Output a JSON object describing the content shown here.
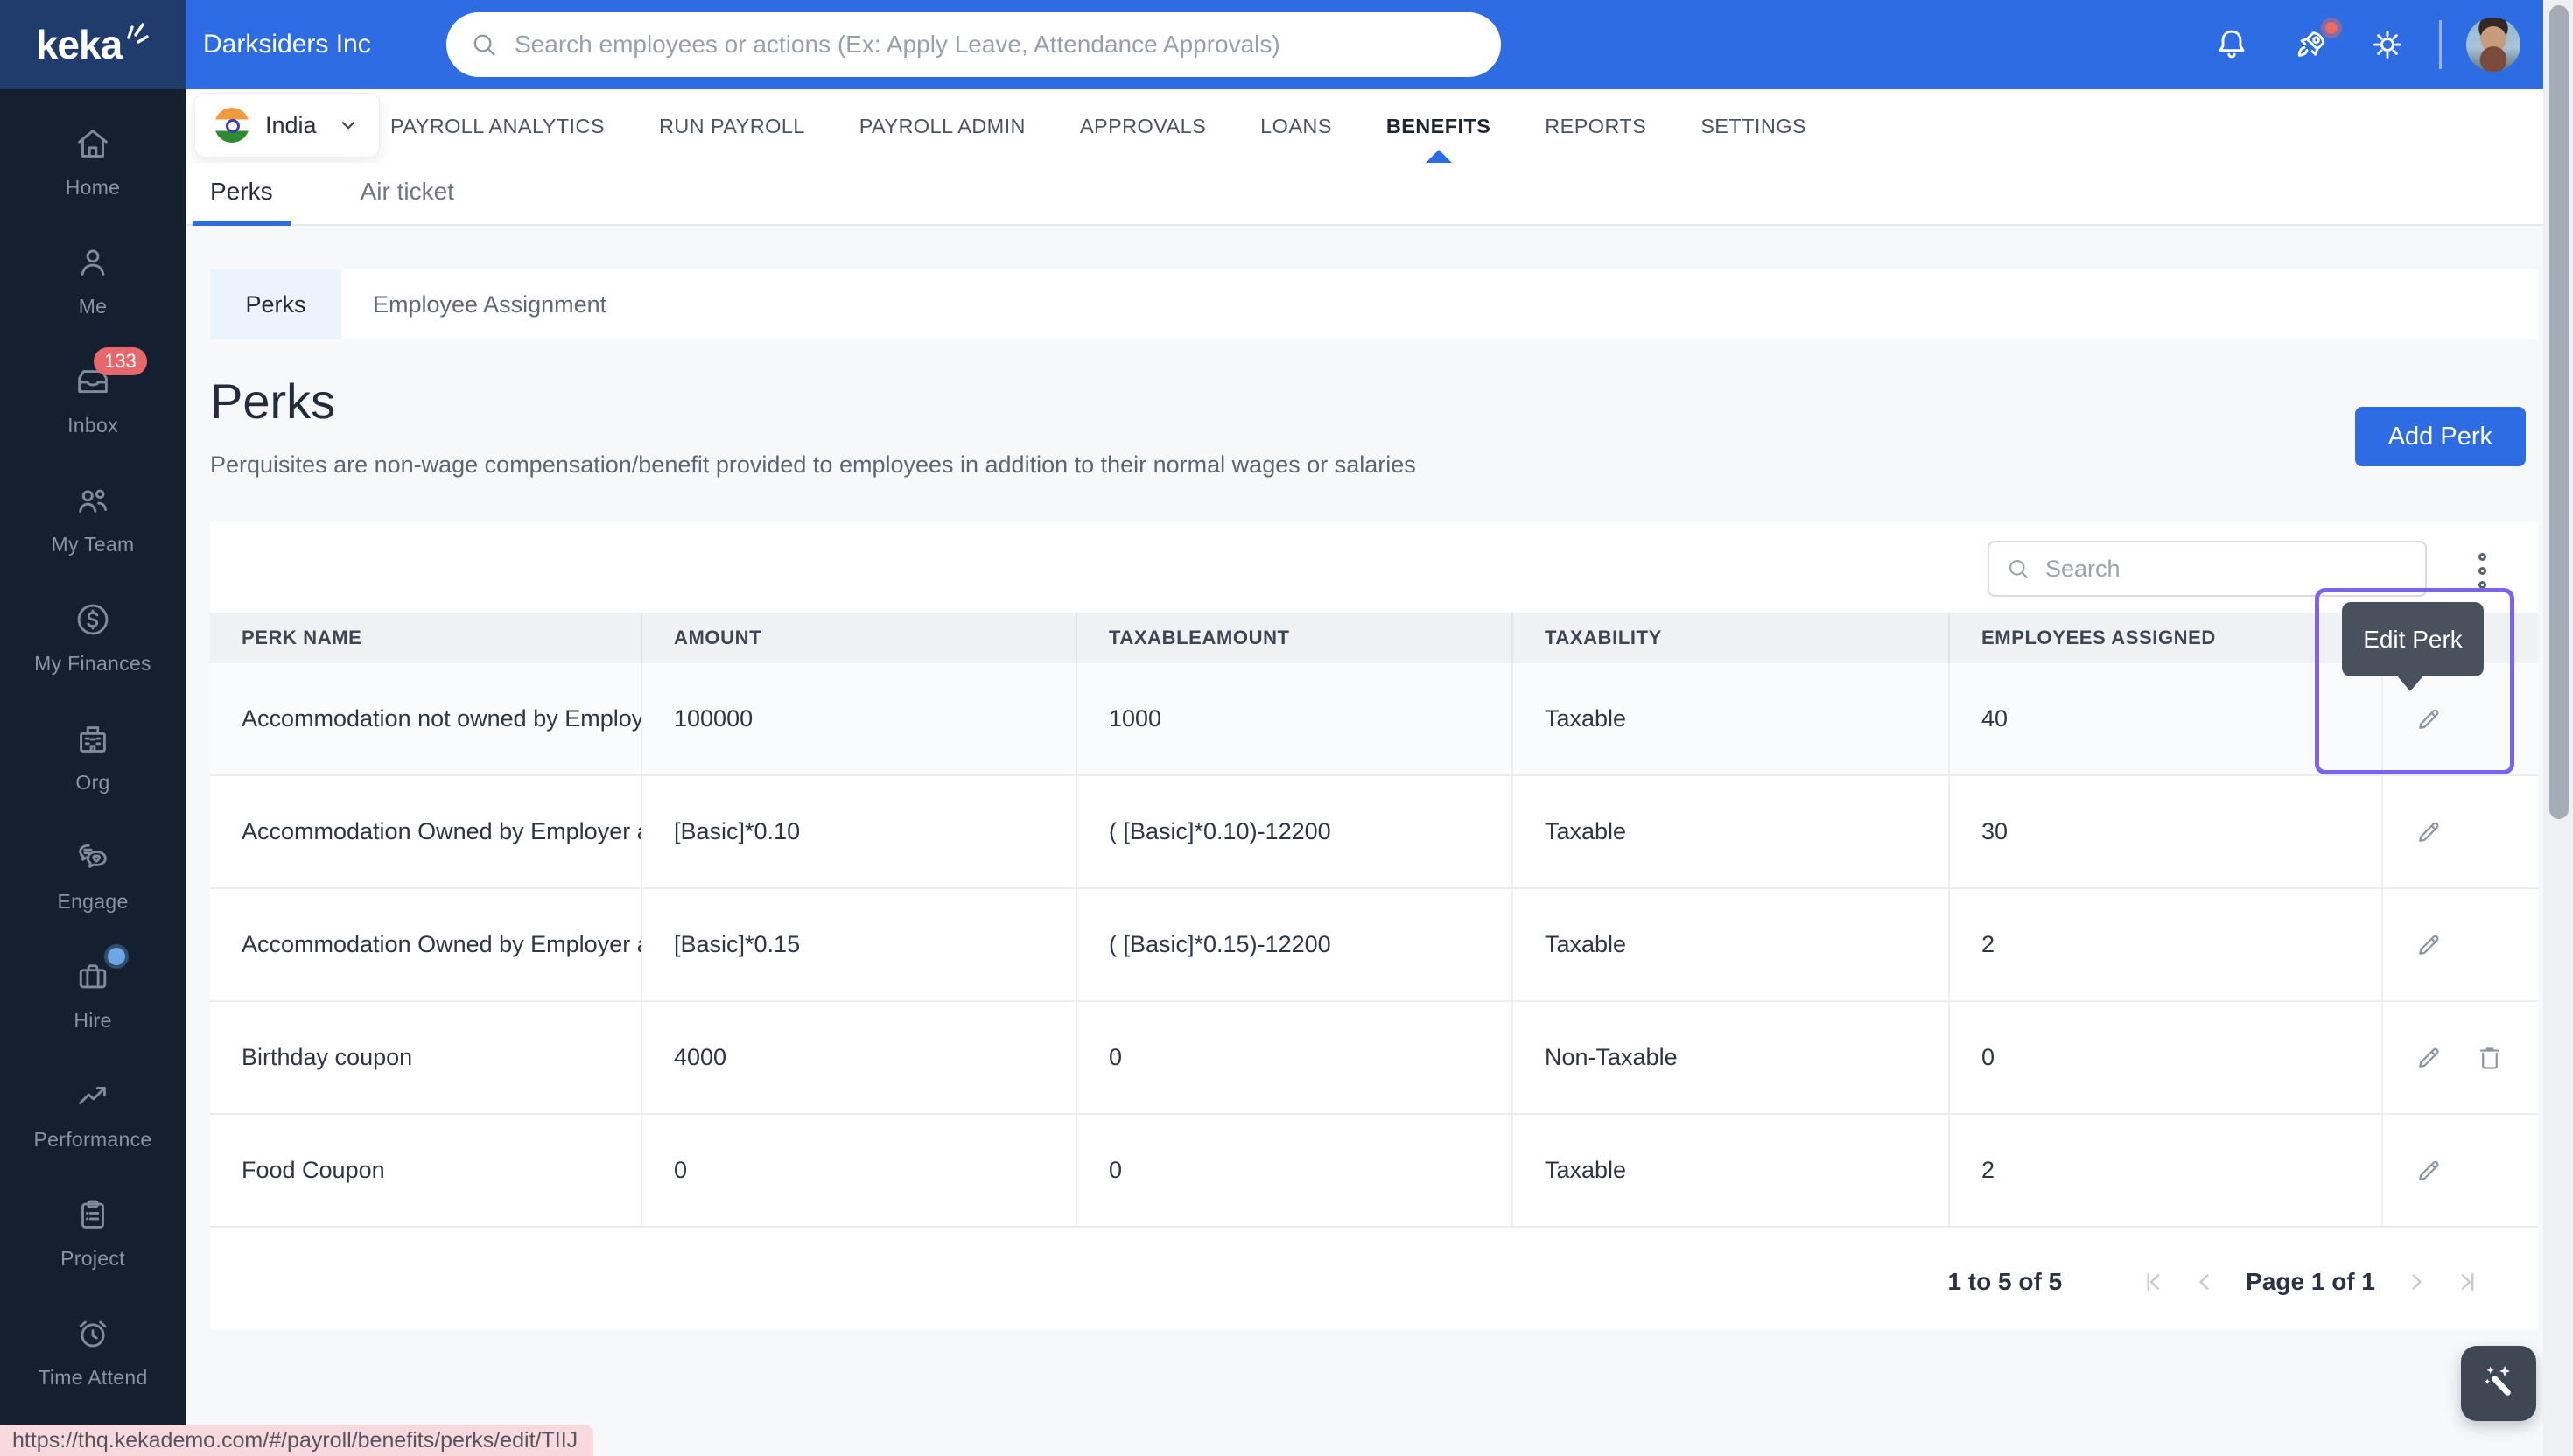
{
  "colors": {
    "header_blue": "#2e6ce3",
    "logo_navy": "#1f3c6d",
    "sidebar_navy": "#14202f",
    "accent_blue": "#2e6ce3",
    "badge_red": "#e7686c",
    "highlight_purple": "#7b62f0",
    "tooltip_slate": "#49515f",
    "statusbar_pink": "#f8d9de"
  },
  "header": {
    "logo": "keka",
    "company": "Darksiders Inc",
    "search_placeholder": "Search employees or actions (Ex: Apply Leave, Attendance Approvals)"
  },
  "sidebar": {
    "items": [
      {
        "label": "Home",
        "icon": "home"
      },
      {
        "label": "Me",
        "icon": "user"
      },
      {
        "label": "Inbox",
        "icon": "inbox",
        "badge": "133"
      },
      {
        "label": "My Team",
        "icon": "team"
      },
      {
        "label": "My Finances",
        "icon": "finance"
      },
      {
        "label": "Org",
        "icon": "org"
      },
      {
        "label": "Engage",
        "icon": "engage"
      },
      {
        "label": "Hire",
        "icon": "hire",
        "dot": true
      },
      {
        "label": "Performance",
        "icon": "performance"
      },
      {
        "label": "Project",
        "icon": "project"
      },
      {
        "label": "Time Attend",
        "icon": "time"
      }
    ]
  },
  "nav": {
    "country": "India",
    "items": [
      "PAYROLL ANALYTICS",
      "RUN PAYROLL",
      "PAYROLL ADMIN",
      "APPROVALS",
      "LOANS",
      "BENEFITS",
      "REPORTS",
      "SETTINGS"
    ],
    "active": "BENEFITS"
  },
  "subtabs": {
    "items": [
      "Perks",
      "Air ticket"
    ],
    "active": "Perks"
  },
  "card_tabs": {
    "items": [
      "Perks",
      "Employee Assignment"
    ],
    "active": "Perks"
  },
  "page": {
    "title": "Perks",
    "description": "Perquisites are non-wage compensation/benefit provided to employees in addition to their normal wages or salaries",
    "add_button": "Add Perk"
  },
  "table": {
    "search_placeholder": "Search",
    "columns": [
      "PERK NAME",
      "AMOUNT",
      "TAXABLEAMOUNT",
      "TAXABILITY",
      "EMPLOYEES ASSIGNED"
    ],
    "rows": [
      {
        "name": "Accommodation not owned by Employe",
        "amount": "100000",
        "taxable_amount": "1000",
        "taxability": "Taxable",
        "employees": "40",
        "delete": false,
        "highlighted": true
      },
      {
        "name": "Accommodation Owned by Employer an",
        "amount": "[Basic]*0.10",
        "taxable_amount": "( [Basic]*0.10)-12200",
        "taxability": "Taxable",
        "employees": "30",
        "delete": false,
        "highlighted": false
      },
      {
        "name": "Accommodation Owned by Employer an",
        "amount": "[Basic]*0.15",
        "taxable_amount": "( [Basic]*0.15)-12200",
        "taxability": "Taxable",
        "employees": "2",
        "delete": false,
        "highlighted": false
      },
      {
        "name": "Birthday coupon",
        "amount": "4000",
        "taxable_amount": "0",
        "taxability": "Non-Taxable",
        "employees": "0",
        "delete": true,
        "highlighted": false
      },
      {
        "name": "Food Coupon",
        "amount": "0",
        "taxable_amount": "0",
        "taxability": "Taxable",
        "employees": "2",
        "delete": false,
        "highlighted": false
      }
    ]
  },
  "tooltip": {
    "label": "Edit Perk"
  },
  "pagination": {
    "range": "1 to 5 of 5",
    "page": "Page 1 of 1"
  },
  "statusbar": {
    "url": "https://thq.kekademo.com/#/payroll/benefits/perks/edit/TIIJ"
  }
}
